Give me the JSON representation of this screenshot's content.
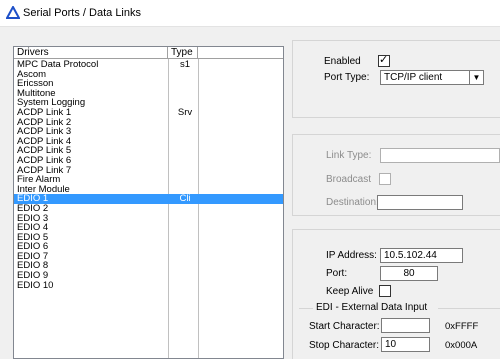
{
  "window": {
    "title": "Serial Ports / Data Links",
    "icon": "triangle-app-icon"
  },
  "drivers_list": {
    "headers": {
      "drivers": "Drivers",
      "type": "Type"
    },
    "rows": [
      {
        "name": "MPC Data Protocol",
        "type": "s1"
      },
      {
        "name": "Ascom",
        "type": ""
      },
      {
        "name": "Ericsson",
        "type": ""
      },
      {
        "name": "Multitone",
        "type": ""
      },
      {
        "name": "System Logging",
        "type": ""
      },
      {
        "name": "ACDP Link   1",
        "type": "Srv"
      },
      {
        "name": "ACDP Link   2",
        "type": ""
      },
      {
        "name": "ACDP Link   3",
        "type": ""
      },
      {
        "name": "ACDP Link   4",
        "type": ""
      },
      {
        "name": "ACDP Link   5",
        "type": ""
      },
      {
        "name": "ACDP Link   6",
        "type": ""
      },
      {
        "name": "ACDP Link   7",
        "type": ""
      },
      {
        "name": "Fire Alarm",
        "type": ""
      },
      {
        "name": "Inter Module",
        "type": ""
      },
      {
        "name": "EDIO 1",
        "type": "Cli",
        "selected": true
      },
      {
        "name": "EDIO 2",
        "type": ""
      },
      {
        "name": "EDIO 3",
        "type": ""
      },
      {
        "name": "EDIO 4",
        "type": ""
      },
      {
        "name": "EDIO 5",
        "type": ""
      },
      {
        "name": "EDIO 6",
        "type": ""
      },
      {
        "name": "EDIO 7",
        "type": ""
      },
      {
        "name": "EDIO 8",
        "type": ""
      },
      {
        "name": "EDIO 9",
        "type": ""
      },
      {
        "name": "EDIO 10",
        "type": ""
      }
    ]
  },
  "settings": {
    "enabled_label": "Enabled",
    "enabled_checked": true,
    "port_type_label": "Port Type:",
    "port_type_value": "TCP/IP client"
  },
  "link": {
    "link_type_label": "Link Type:",
    "broadcast_label": "Broadcast",
    "destination_label": "Destination:"
  },
  "network": {
    "ip_label": "IP Address:",
    "ip_value": "10.5.102.44",
    "port_label": "Port:",
    "port_value": "80",
    "keep_alive_label": "Keep Alive",
    "edi_group_label": "EDI - External Data Input",
    "start_char_label": "Start Character:",
    "start_char_value": "",
    "start_char_hex": "0xFFFF",
    "stop_char_label": "Stop Character:",
    "stop_char_value": "10",
    "stop_char_hex": "0x000A"
  },
  "colors": {
    "selection": "#3399ff",
    "title_icon": "#1e50c8"
  }
}
